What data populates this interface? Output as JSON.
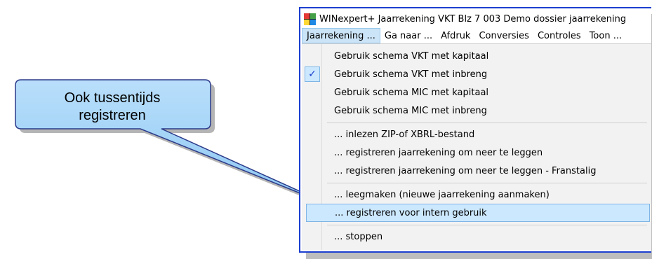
{
  "callout": {
    "line1": "Ook tussentijds",
    "line2": "registreren",
    "fill": "#9fd0f7"
  },
  "window": {
    "title": "WINexpert+ Jaarrekening VKT Blz 7   003 Demo dossier jaarrekening",
    "border_color": "#1c3fcf",
    "icon": "winexpert-app-icon"
  },
  "menubar": {
    "items": [
      {
        "label": "Jaarrekening ..."
      },
      {
        "label": "Ga naar ..."
      },
      {
        "label": "Afdruk"
      },
      {
        "label": "Conversies"
      },
      {
        "label": "Controles"
      },
      {
        "label": "Toon ..."
      }
    ]
  },
  "dropdown": {
    "items": [
      {
        "label": "Gebruik schema VKT met kapitaal"
      },
      {
        "label": "Gebruik schema VKT met inbreng",
        "checked": true,
        "check_icon": "checkmark-icon"
      },
      {
        "label": "Gebruik schema MIC met kapitaal"
      },
      {
        "label": "Gebruik schema MIC met inbreng"
      },
      {
        "label": "... inlezen ZIP-of XBRL-bestand"
      },
      {
        "label": "... registreren jaarrekening om neer te leggen"
      },
      {
        "label": "... registreren jaarrekening om neer te leggen - Franstalig"
      },
      {
        "label": "... leegmaken (nieuwe jaarrekening aanmaken)"
      },
      {
        "label": "... registreren voor intern gebruik",
        "highlighted": true
      },
      {
        "label": "... stoppen"
      }
    ]
  }
}
